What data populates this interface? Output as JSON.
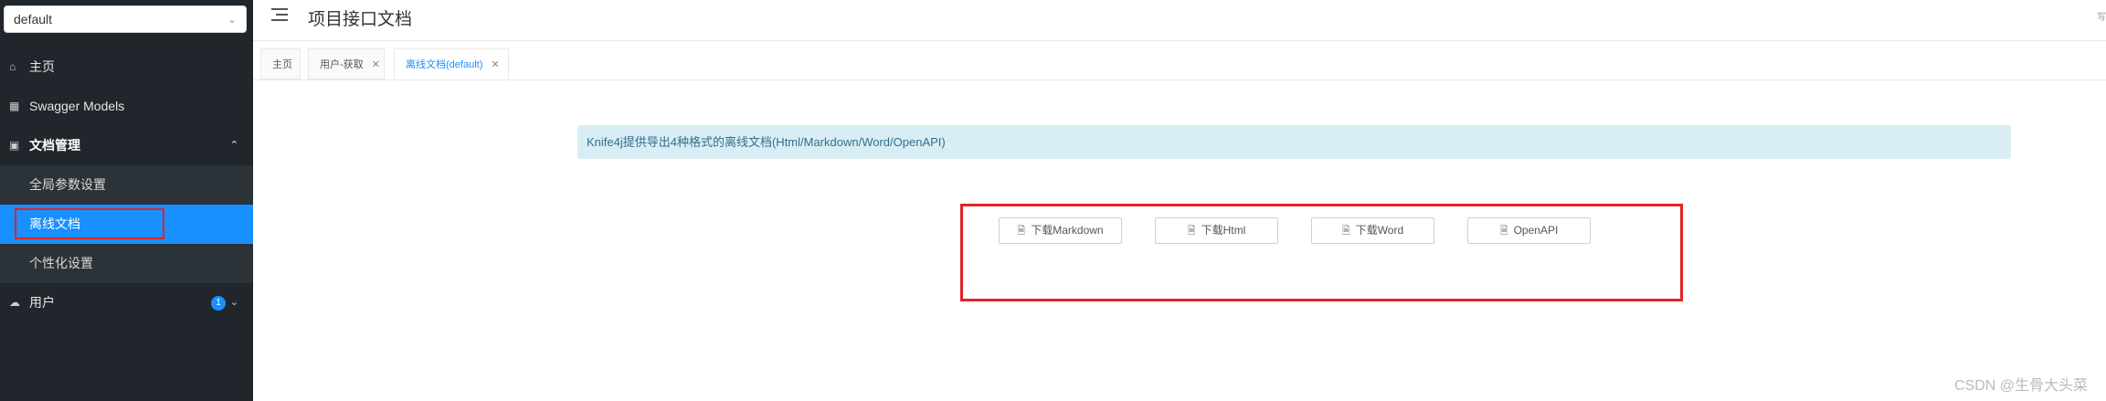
{
  "sidebar": {
    "group_select": "default",
    "items": [
      {
        "label": "主页",
        "icon": "home-icon"
      },
      {
        "label": "Swagger Models",
        "icon": "cube-icon"
      },
      {
        "label": "文档管理",
        "icon": "doc-icon"
      },
      {
        "label": "用户",
        "icon": "cloud-icon",
        "badge": "1"
      }
    ],
    "submenu": [
      {
        "label": "全局参数设置"
      },
      {
        "label": "离线文档"
      },
      {
        "label": "个性化设置"
      }
    ]
  },
  "header": {
    "title": "项目接口文档",
    "right_text": "写"
  },
  "tabs": [
    {
      "label": "主页"
    },
    {
      "label": "用户-获取"
    },
    {
      "label": "离线文档(default)"
    }
  ],
  "content": {
    "alert": "Knife4j提供导出4种格式的离线文档(Html/Markdown/Word/OpenAPI)",
    "buttons": [
      {
        "label": "下载Markdown"
      },
      {
        "label": "下载Html"
      },
      {
        "label": "下载Word"
      },
      {
        "label": "OpenAPI"
      }
    ]
  },
  "watermark": "CSDN @生骨大头菜",
  "colors": {
    "sidebar_bg": "#20262c",
    "active_blue": "#1890ff",
    "highlight_red": "#e02424",
    "alert_bg": "#d9edf5"
  }
}
